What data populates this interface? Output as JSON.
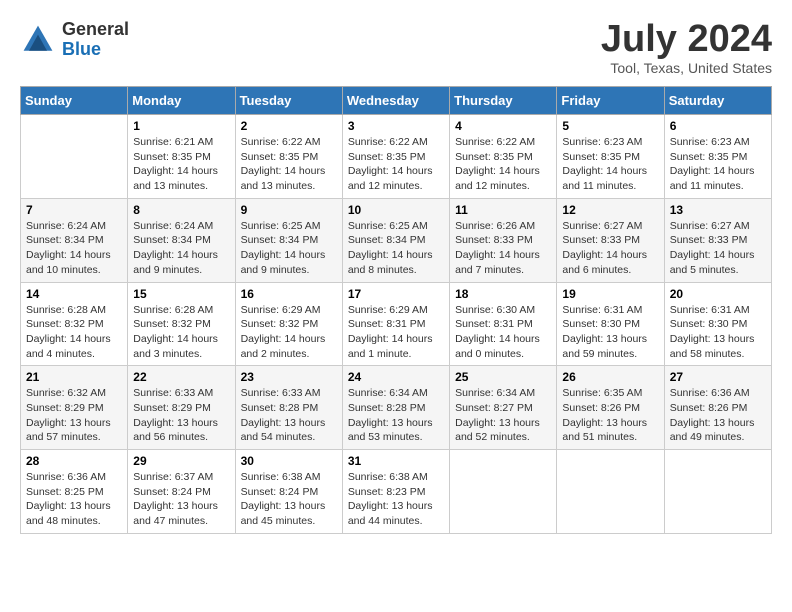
{
  "header": {
    "logo_general": "General",
    "logo_blue": "Blue",
    "title": "July 2024",
    "subtitle": "Tool, Texas, United States"
  },
  "days_of_week": [
    "Sunday",
    "Monday",
    "Tuesday",
    "Wednesday",
    "Thursday",
    "Friday",
    "Saturday"
  ],
  "weeks": [
    [
      {
        "day": "",
        "info": ""
      },
      {
        "day": "1",
        "info": "Sunrise: 6:21 AM\nSunset: 8:35 PM\nDaylight: 14 hours\nand 13 minutes."
      },
      {
        "day": "2",
        "info": "Sunrise: 6:22 AM\nSunset: 8:35 PM\nDaylight: 14 hours\nand 13 minutes."
      },
      {
        "day": "3",
        "info": "Sunrise: 6:22 AM\nSunset: 8:35 PM\nDaylight: 14 hours\nand 12 minutes."
      },
      {
        "day": "4",
        "info": "Sunrise: 6:22 AM\nSunset: 8:35 PM\nDaylight: 14 hours\nand 12 minutes."
      },
      {
        "day": "5",
        "info": "Sunrise: 6:23 AM\nSunset: 8:35 PM\nDaylight: 14 hours\nand 11 minutes."
      },
      {
        "day": "6",
        "info": "Sunrise: 6:23 AM\nSunset: 8:35 PM\nDaylight: 14 hours\nand 11 minutes."
      }
    ],
    [
      {
        "day": "7",
        "info": "Sunrise: 6:24 AM\nSunset: 8:34 PM\nDaylight: 14 hours\nand 10 minutes."
      },
      {
        "day": "8",
        "info": "Sunrise: 6:24 AM\nSunset: 8:34 PM\nDaylight: 14 hours\nand 9 minutes."
      },
      {
        "day": "9",
        "info": "Sunrise: 6:25 AM\nSunset: 8:34 PM\nDaylight: 14 hours\nand 9 minutes."
      },
      {
        "day": "10",
        "info": "Sunrise: 6:25 AM\nSunset: 8:34 PM\nDaylight: 14 hours\nand 8 minutes."
      },
      {
        "day": "11",
        "info": "Sunrise: 6:26 AM\nSunset: 8:33 PM\nDaylight: 14 hours\nand 7 minutes."
      },
      {
        "day": "12",
        "info": "Sunrise: 6:27 AM\nSunset: 8:33 PM\nDaylight: 14 hours\nand 6 minutes."
      },
      {
        "day": "13",
        "info": "Sunrise: 6:27 AM\nSunset: 8:33 PM\nDaylight: 14 hours\nand 5 minutes."
      }
    ],
    [
      {
        "day": "14",
        "info": "Sunrise: 6:28 AM\nSunset: 8:32 PM\nDaylight: 14 hours\nand 4 minutes."
      },
      {
        "day": "15",
        "info": "Sunrise: 6:28 AM\nSunset: 8:32 PM\nDaylight: 14 hours\nand 3 minutes."
      },
      {
        "day": "16",
        "info": "Sunrise: 6:29 AM\nSunset: 8:32 PM\nDaylight: 14 hours\nand 2 minutes."
      },
      {
        "day": "17",
        "info": "Sunrise: 6:29 AM\nSunset: 8:31 PM\nDaylight: 14 hours\nand 1 minute."
      },
      {
        "day": "18",
        "info": "Sunrise: 6:30 AM\nSunset: 8:31 PM\nDaylight: 14 hours\nand 0 minutes."
      },
      {
        "day": "19",
        "info": "Sunrise: 6:31 AM\nSunset: 8:30 PM\nDaylight: 13 hours\nand 59 minutes."
      },
      {
        "day": "20",
        "info": "Sunrise: 6:31 AM\nSunset: 8:30 PM\nDaylight: 13 hours\nand 58 minutes."
      }
    ],
    [
      {
        "day": "21",
        "info": "Sunrise: 6:32 AM\nSunset: 8:29 PM\nDaylight: 13 hours\nand 57 minutes."
      },
      {
        "day": "22",
        "info": "Sunrise: 6:33 AM\nSunset: 8:29 PM\nDaylight: 13 hours\nand 56 minutes."
      },
      {
        "day": "23",
        "info": "Sunrise: 6:33 AM\nSunset: 8:28 PM\nDaylight: 13 hours\nand 54 minutes."
      },
      {
        "day": "24",
        "info": "Sunrise: 6:34 AM\nSunset: 8:28 PM\nDaylight: 13 hours\nand 53 minutes."
      },
      {
        "day": "25",
        "info": "Sunrise: 6:34 AM\nSunset: 8:27 PM\nDaylight: 13 hours\nand 52 minutes."
      },
      {
        "day": "26",
        "info": "Sunrise: 6:35 AM\nSunset: 8:26 PM\nDaylight: 13 hours\nand 51 minutes."
      },
      {
        "day": "27",
        "info": "Sunrise: 6:36 AM\nSunset: 8:26 PM\nDaylight: 13 hours\nand 49 minutes."
      }
    ],
    [
      {
        "day": "28",
        "info": "Sunrise: 6:36 AM\nSunset: 8:25 PM\nDaylight: 13 hours\nand 48 minutes."
      },
      {
        "day": "29",
        "info": "Sunrise: 6:37 AM\nSunset: 8:24 PM\nDaylight: 13 hours\nand 47 minutes."
      },
      {
        "day": "30",
        "info": "Sunrise: 6:38 AM\nSunset: 8:24 PM\nDaylight: 13 hours\nand 45 minutes."
      },
      {
        "day": "31",
        "info": "Sunrise: 6:38 AM\nSunset: 8:23 PM\nDaylight: 13 hours\nand 44 minutes."
      },
      {
        "day": "",
        "info": ""
      },
      {
        "day": "",
        "info": ""
      },
      {
        "day": "",
        "info": ""
      }
    ]
  ]
}
